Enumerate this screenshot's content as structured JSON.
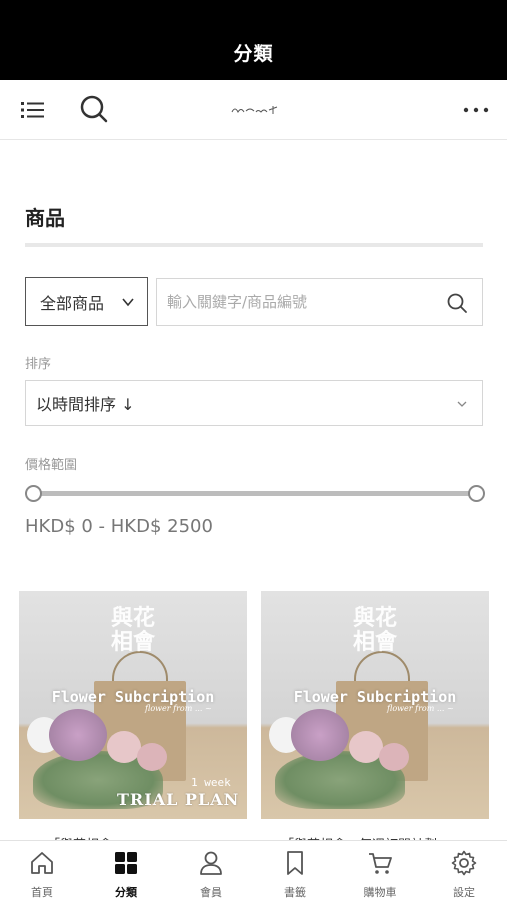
{
  "header": {
    "title": "分類"
  },
  "navbar": {
    "logo_text": "Flower from ... ~"
  },
  "main": {
    "section_title": "商品",
    "category_select": {
      "value": "全部商品"
    },
    "search": {
      "placeholder": "輸入關鍵字/商品編號"
    },
    "sort": {
      "label": "排序",
      "value": "以時間排序 ↓"
    },
    "price": {
      "label": "價格範圍",
      "range_text": "HKD$ 0 - HKD$ 2500",
      "min_fraction": 0,
      "max_fraction": 1
    }
  },
  "products": [
    {
      "image": {
        "brand_line1": "與花",
        "brand_line2": "相會",
        "subtitle": "Flower Subcription",
        "script": "flower from ... ~",
        "week": "1 week",
        "plan": "TRIAL PLAN"
      },
      "name": "「與花相會」..."
    },
    {
      "image": {
        "brand_line1": "與花",
        "brand_line2": "相會",
        "subtitle": "Flower Subcription",
        "script": "flower from ... ~"
      },
      "name": "「與花相會」每週訂閱計劃"
    }
  ],
  "tabbar": {
    "items": [
      {
        "label": "首頁",
        "icon": "home-icon"
      },
      {
        "label": "分類",
        "icon": "grid-icon",
        "active": true
      },
      {
        "label": "會員",
        "icon": "user-icon"
      },
      {
        "label": "書籤",
        "icon": "bookmark-icon"
      },
      {
        "label": "購物車",
        "icon": "cart-icon"
      },
      {
        "label": "設定",
        "icon": "gear-icon"
      }
    ]
  }
}
